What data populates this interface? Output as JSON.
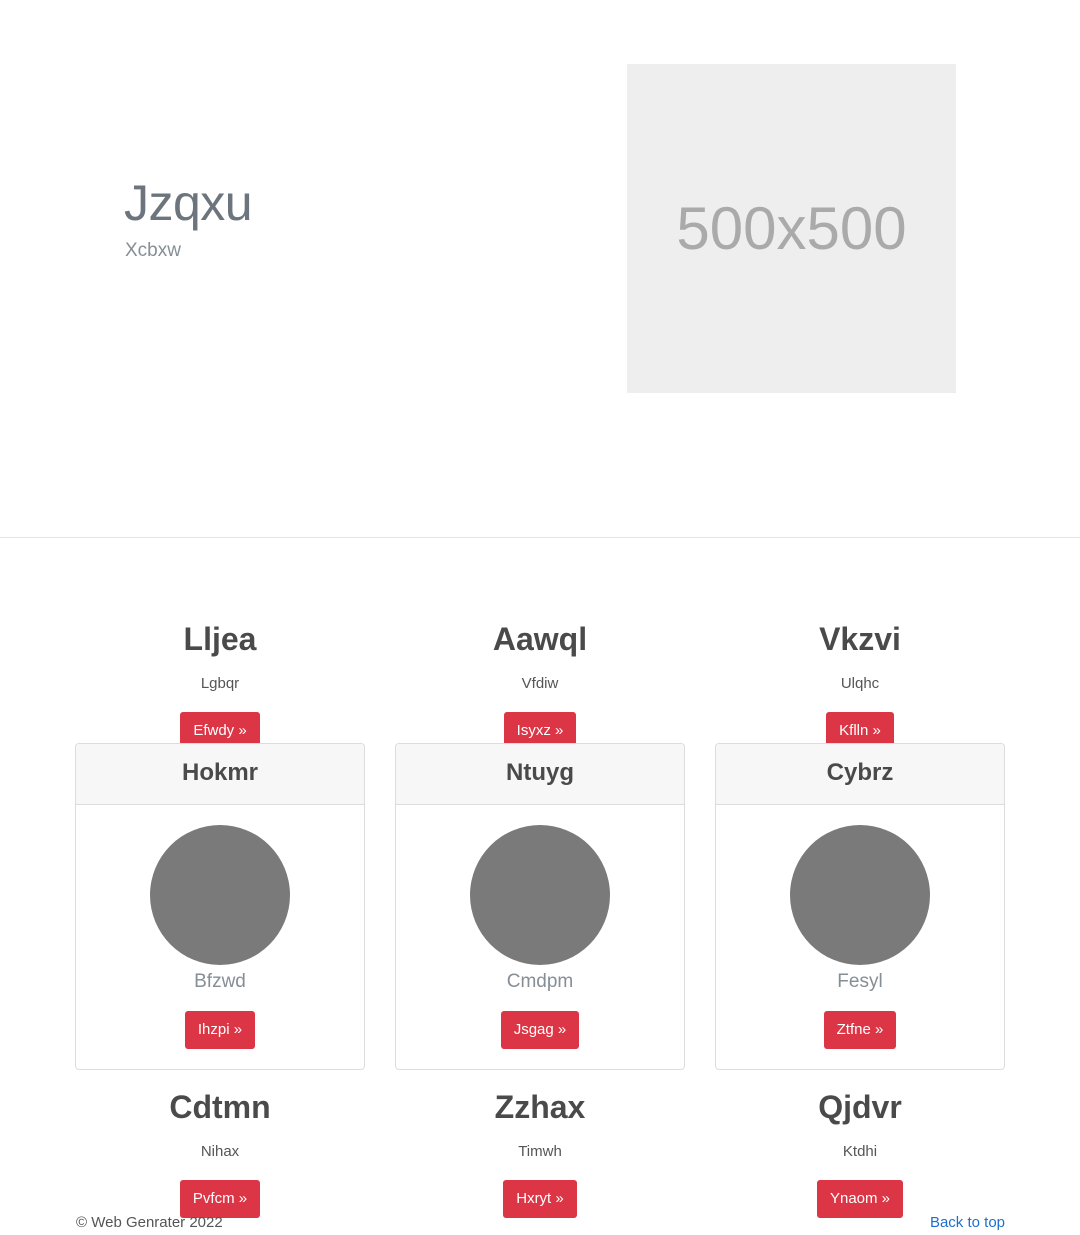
{
  "hero": {
    "title": "Jzqxu",
    "subtitle": "Xcbxw",
    "image_label": "500x500"
  },
  "features_top": [
    {
      "title": "Lljea",
      "text": "Lgbqr",
      "button": "Efwdy »"
    },
    {
      "title": "Aawql",
      "text": "Vfdiw",
      "button": "Isyxz »"
    },
    {
      "title": "Vkzvi",
      "text": "Ulqhc",
      "button": "Kflln »"
    }
  ],
  "cards": [
    {
      "header": "Hokmr",
      "text": "Bfzwd",
      "button": "Ihzpi »"
    },
    {
      "header": "Ntuyg",
      "text": "Cmdpm",
      "button": "Jsgag »"
    },
    {
      "header": "Cybrz",
      "text": "Fesyl",
      "button": "Ztfne »"
    }
  ],
  "features_bottom": [
    {
      "title": "Cdtmn",
      "text": "Nihax",
      "button": "Pvfcm »"
    },
    {
      "title": "Zzhax",
      "text": "Timwh",
      "button": "Hxryt »"
    },
    {
      "title": "Qjdvr",
      "text": "Ktdhi",
      "button": "Ynaom »"
    }
  ],
  "footer": {
    "copyright": "© Web Genrater 2022",
    "back_to_top": "Back to top"
  },
  "colors": {
    "button_red": "#dc3545",
    "avatar_gray": "#7a7a7a",
    "link_blue": "#1f6fd0"
  }
}
